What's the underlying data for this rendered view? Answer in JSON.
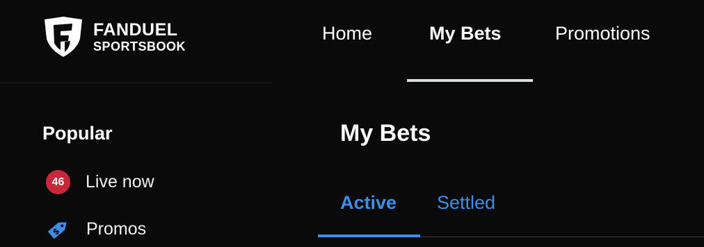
{
  "brand": {
    "line1": "FANDUEL",
    "line2": "SPORTSBOOK",
    "logo_icon": "fanduel-shield-icon"
  },
  "topnav": {
    "items": [
      {
        "label": "Home"
      },
      {
        "label": "My Bets",
        "active": true
      },
      {
        "label": "Promotions"
      }
    ]
  },
  "sidebar": {
    "heading": "Popular",
    "items": [
      {
        "label": "Live now",
        "badge": "46",
        "icon": "live-count-badge"
      },
      {
        "label": "Promos",
        "icon": "price-tag-icon"
      }
    ]
  },
  "main": {
    "title": "My Bets",
    "tabs": [
      {
        "label": "Active",
        "active": true
      },
      {
        "label": "Settled"
      }
    ]
  },
  "colors": {
    "background": "#0a0a0a",
    "accent_blue": "#3f8dea",
    "badge_red": "#c8283a",
    "nav_underline": "#d8dce3"
  }
}
